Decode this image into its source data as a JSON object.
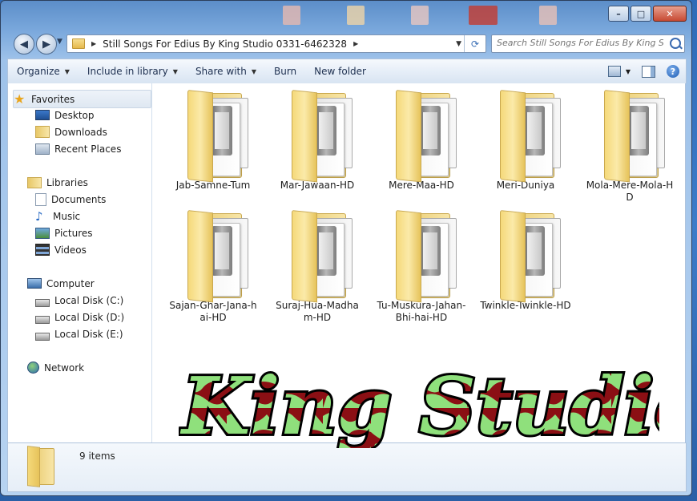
{
  "window": {
    "controls": {
      "minimize": "–",
      "maximize": "□",
      "close": "✕"
    }
  },
  "address": {
    "path": "Still Songs For Edius By King Studio 0331-6462328",
    "search_placeholder": "Search Still Songs For Edius By King St..."
  },
  "toolbar": {
    "items": [
      "Organize",
      "Include in library",
      "Share with",
      "Burn",
      "New folder"
    ]
  },
  "sidebar": {
    "favorites_label": "Favorites",
    "favorites": [
      "Desktop",
      "Downloads",
      "Recent Places"
    ],
    "libraries_label": "Libraries",
    "libraries": [
      "Documents",
      "Music",
      "Pictures",
      "Videos"
    ],
    "computer_label": "Computer",
    "drives": [
      "Local Disk (C:)",
      "Local Disk (D:)",
      "Local Disk (E:)"
    ],
    "network_label": "Network"
  },
  "files": [
    "Jab-Samne-Tum",
    "Mar-Jawaan-HD",
    "Mere-Maa-HD",
    "Meri-Duniya",
    "Mola-Mere-Mola-HD",
    "Sajan-Ghar-Jana-hai-HD",
    "Suraj-Hua-Madham-HD",
    "Tu-Muskura-Jahan-Bhi-hai-HD",
    "Twinkle-Twinkle-HD"
  ],
  "details": {
    "count_text": "9 items"
  },
  "watermark": {
    "text": "King Studio",
    "colors": {
      "fill": "#8b0f14",
      "accent": "#8fe07c",
      "outline": "#000000"
    }
  },
  "colors": {
    "accent": "#3a6ab0",
    "folder": "#f3d77a"
  }
}
